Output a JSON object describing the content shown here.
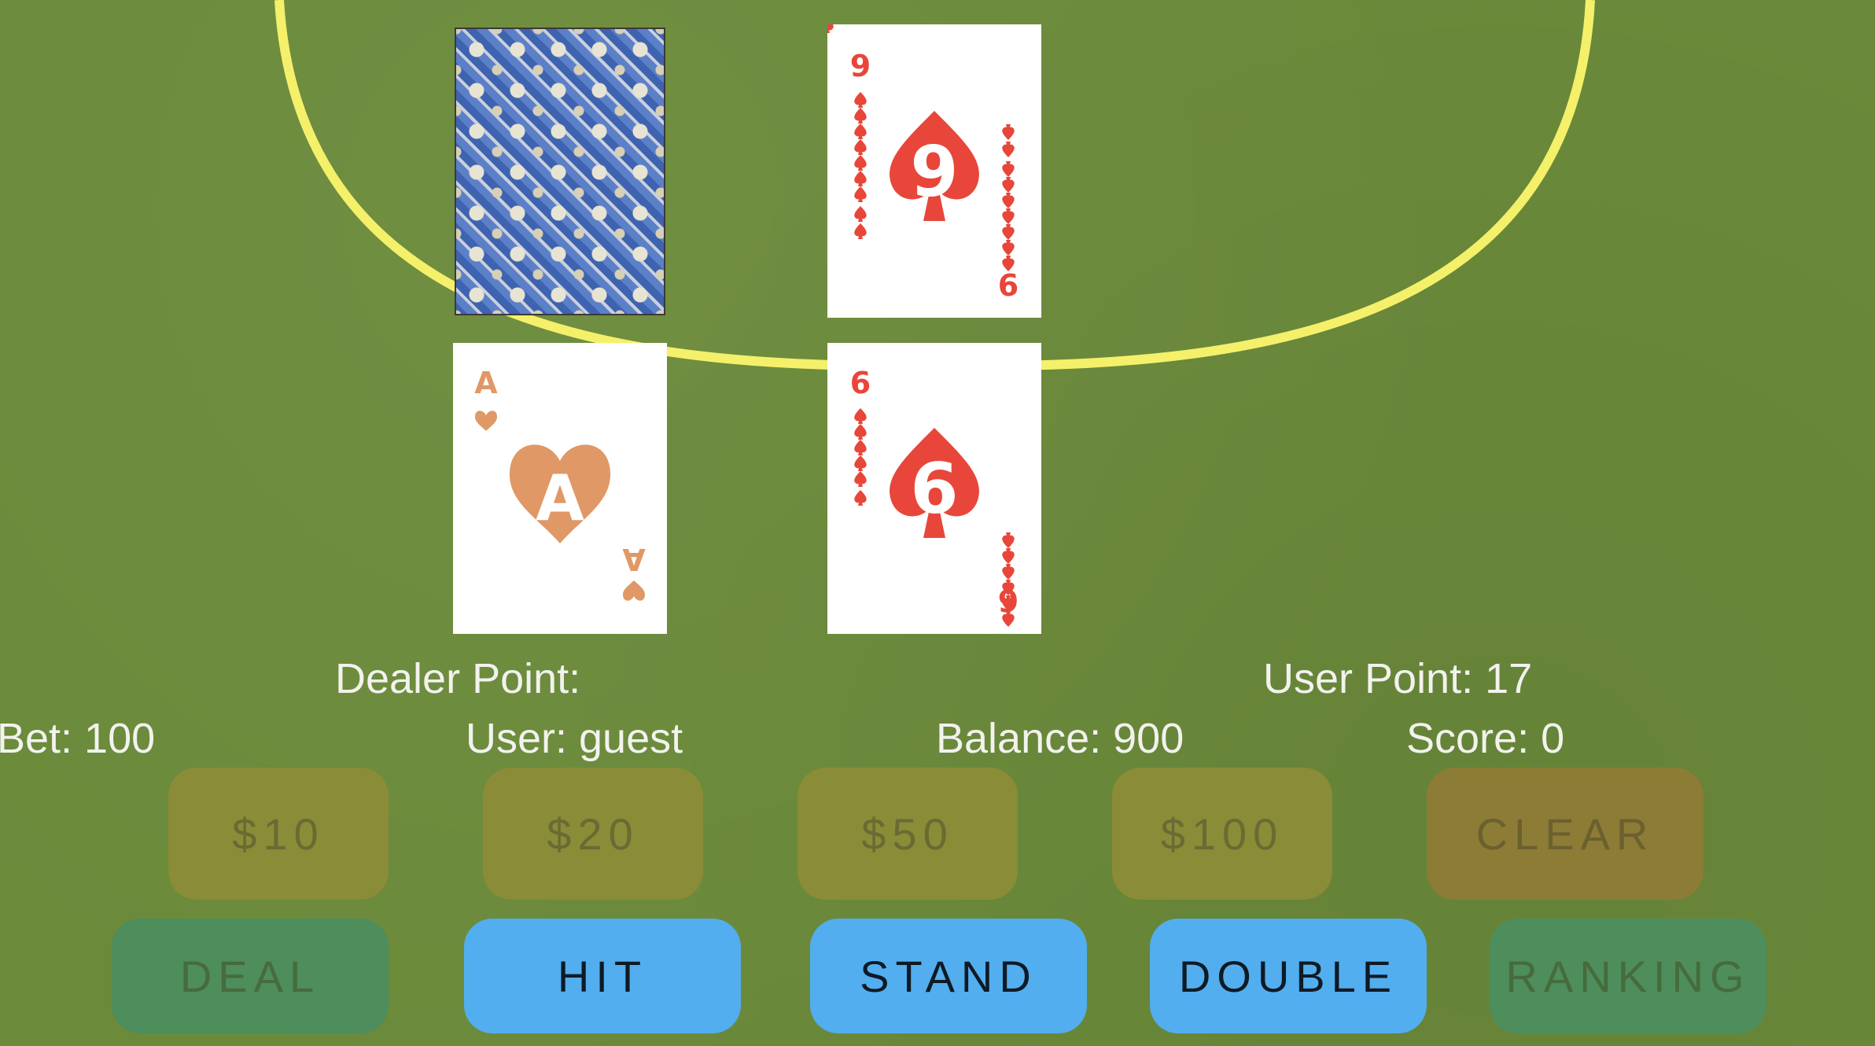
{
  "table": {
    "arc_color": "#f5f06a",
    "felt_color": "#6b8a3a"
  },
  "dealer": {
    "cards": [
      {
        "face": "back"
      },
      {
        "face": "up",
        "rank_top": "9",
        "rank_bottom": "6",
        "suit": "spade",
        "center": "9",
        "color": "#e8463a"
      }
    ],
    "point_label": "Dealer Point:"
  },
  "user": {
    "cards": [
      {
        "face": "up",
        "rank_top": "A",
        "rank_bottom": "A",
        "suit": "heart",
        "center": "A",
        "color": "#df9866"
      },
      {
        "face": "up",
        "rank_top": "6",
        "rank_bottom": "9",
        "suit": "spade",
        "center": "6",
        "color": "#e8463a"
      }
    ],
    "point_label": "User Point: 17"
  },
  "status": {
    "bet": "Bet: 100",
    "user": "User: guest",
    "balance": "Balance: 900",
    "score": "Score: 0"
  },
  "chips": [
    "$10",
    "$20",
    "$50",
    "$100"
  ],
  "clear_label": "CLEAR",
  "actions": {
    "deal": "DEAL",
    "hit": "HIT",
    "stand": "STAND",
    "double": "DOUBLE",
    "ranking": "RANKING"
  }
}
